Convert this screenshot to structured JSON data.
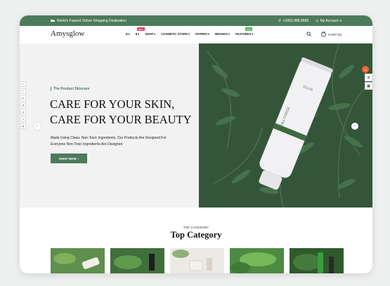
{
  "topbar": {
    "promo": "World's Fastest Online Shopping Destination",
    "phone": "+(000) 888 8888",
    "account": "My Account"
  },
  "header": {
    "logo": "Amysglow",
    "nav": [
      {
        "label": "",
        "icon": "graduation-cap-icon"
      },
      {
        "label": "",
        "icon": "graduation-cap-icon",
        "badge": "NEW",
        "badge_color": "#e8305a"
      },
      {
        "label": "SHOP"
      },
      {
        "label": "COSMETIC STORE"
      },
      {
        "label": "OFFERS"
      },
      {
        "label": "BRANDS"
      },
      {
        "label": "FEATURES",
        "badge": "HOT",
        "badge_color": "#4caf50"
      }
    ],
    "cart": "CART (0)"
  },
  "hero": {
    "tagline": "The Product Skincare",
    "title_line1": "CARE FOR YOUR SKIN,",
    "title_line2": "CARE FOR YOUR BEAUTY",
    "desc_line1": "Made Using Clean, Non-Toxic Ingredients, Our Products Are Designed For",
    "desc_line2": "Everyone Non-Toxic Ingredients Are Designed",
    "button": "SHOP NOW",
    "tube_brand": "OLLIN",
    "tube_line": "FULL FORCE",
    "social": [
      "f",
      "t",
      "in",
      "yt",
      "p",
      "v",
      "ig"
    ]
  },
  "category": {
    "kicker": "TOP CATEGORY",
    "title": "Top Category"
  },
  "colors": {
    "accent": "#4d7a5c",
    "sale_badge": "#f06236"
  }
}
